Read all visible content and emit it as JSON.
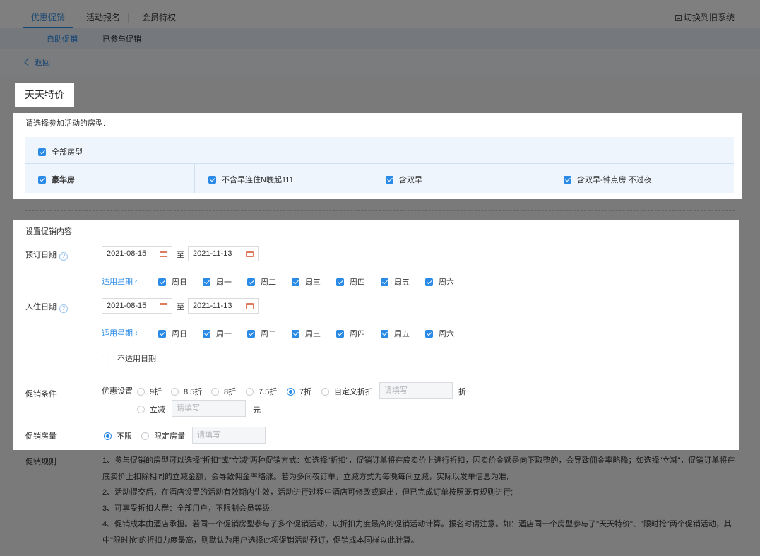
{
  "top_tabs": [
    {
      "label": "优惠促销",
      "active": true
    },
    {
      "label": "活动报名",
      "active": false
    },
    {
      "label": "会员特权",
      "active": false
    }
  ],
  "switch_label": "切换到旧系统",
  "sub_tabs": [
    {
      "label": "自助促销",
      "active": true
    },
    {
      "label": "已参与促销",
      "active": false
    }
  ],
  "back_label": "返回",
  "page_title": "天天特价",
  "room_section": {
    "label": "请选择参加活动的房型:",
    "all_rooms": {
      "label": "全部房型",
      "checked": true
    },
    "group": {
      "label": "豪华房",
      "checked": true
    },
    "rooms": [
      {
        "label": "不含早连住N晚起111",
        "checked": true
      },
      {
        "label": "含双早",
        "checked": true
      },
      {
        "label": "含双早-钟点房 不过夜",
        "checked": true
      }
    ]
  },
  "promo_section": {
    "label": "设置促销内容:",
    "booking_date": {
      "label": "预订日期",
      "start": "2021-08-15",
      "to": "至",
      "end": "2021-11-13",
      "weekday_label": "适用星期",
      "weekdays": [
        "周日",
        "周一",
        "周二",
        "周三",
        "周四",
        "周五",
        "周六"
      ]
    },
    "checkin_date": {
      "label": "入住日期",
      "start": "2021-08-15",
      "to": "至",
      "end": "2021-11-13",
      "weekday_label": "适用星期",
      "weekdays": [
        "周日",
        "周一",
        "周二",
        "周三",
        "周四",
        "周五",
        "周六"
      ]
    },
    "exclude_dates": {
      "label": "不适用日期",
      "checked": false
    },
    "condition": {
      "label": "促销条件",
      "sub_label": "优惠设置",
      "options": [
        "9折",
        "8.5折",
        "8折",
        "7.5折",
        "7折",
        "自定义折扣"
      ],
      "selected": "7折",
      "custom_placeholder": "请填写",
      "custom_unit": "折",
      "reduce_label": "立减",
      "reduce_placeholder": "请填写",
      "reduce_unit": "元"
    },
    "room_qty": {
      "label": "促销房量",
      "options": [
        "不限",
        "限定房量"
      ],
      "selected": "不限",
      "placeholder": "请填写"
    }
  },
  "rules": {
    "label": "促销规则",
    "lines": [
      "1、参与促销的房型可以选择\"折扣\"或\"立减\"两种促销方式：如选择\"折扣\"，促销订单将在底卖价上进行折扣，因卖价金额是向下取整的，会导致佣金率略降；如选择\"立减\"，促销订单将在底卖价上扣除相同的立减金额，会导致佣金率略涨。若为多间夜订单，立减方式为每晚每间立减，实际以发单信息为准;",
      "2、活动提交后，在酒店设置的活动有效期内生效，活动进行过程中酒店可修改或退出，但已完成订单按照既有规则进行;",
      "3、可享受折扣人群：全部用户，不限制会员等级;",
      "4、促销成本由酒店承担。若同一个促销房型参与了多个促销活动，以折扣力度最高的促销活动计算。报名时请注意。如：酒店同一个房型参与了\"天天特价\"、\"限时抢\"两个促销活动，其中\"限时抢\"的折扣力度最高，则默认为用户选择此项促销活动预订，促销成本同样以此计算。"
    ]
  },
  "colors": {
    "accent": "#2a8ae6",
    "sub_tab_bg": "#eaf3fd",
    "room_table_bg": "#eef5fd"
  }
}
